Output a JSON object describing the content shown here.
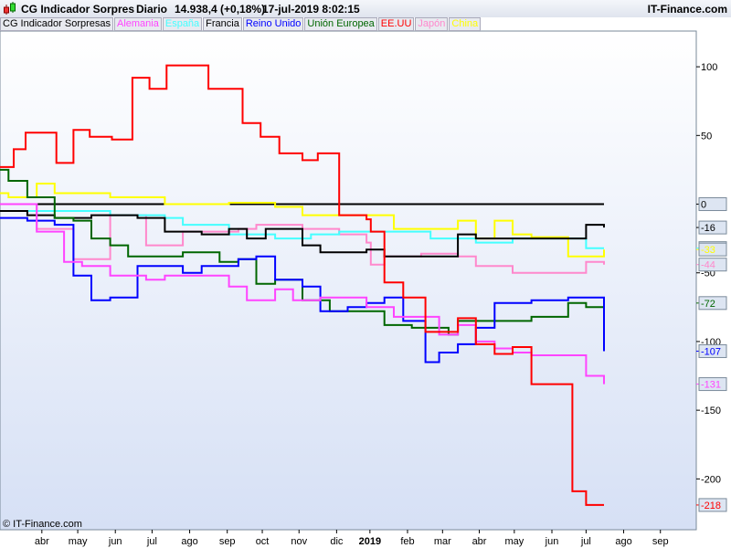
{
  "header": {
    "title": "CG Indicador Sorpres",
    "period": "Diario",
    "value": "14.938,4 (+0,18%)",
    "datetime": "17-jul-2019 8:02:15",
    "site": "IT-Finance.com"
  },
  "legend": [
    {
      "label": "CG Indicador Sorpresas",
      "color": "#000000"
    },
    {
      "label": "Alemania",
      "color": "#ff44ff"
    },
    {
      "label": "España",
      "color": "#44ffff"
    },
    {
      "label": "Francia",
      "color": "#000000"
    },
    {
      "label": "Reino Unido",
      "color": "#0000ff"
    },
    {
      "label": "Unión Europea",
      "color": "#006600"
    },
    {
      "label": "EE.UU",
      "color": "#ff0000"
    },
    {
      "label": "Japón",
      "color": "#ff88cc"
    },
    {
      "label": "China",
      "color": "#ffff00"
    }
  ],
  "copyright": "© IT-Finance.com",
  "chart_data": {
    "type": "line",
    "x_unit": "weeks since mid-March 2018",
    "xlim": [
      0,
      81.5
    ],
    "ylim": [
      -237,
      126
    ],
    "yticks": [
      100,
      50,
      0,
      -50,
      -100,
      -150,
      -200
    ],
    "xticks": [
      {
        "x": 4.9,
        "label": "abr"
      },
      {
        "x": 9.1,
        "label": "may"
      },
      {
        "x": 13.5,
        "label": "jun"
      },
      {
        "x": 17.8,
        "label": "jul"
      },
      {
        "x": 22.2,
        "label": "ago"
      },
      {
        "x": 26.6,
        "label": "sep"
      },
      {
        "x": 30.7,
        "label": "oct"
      },
      {
        "x": 35,
        "label": "nov"
      },
      {
        "x": 39.4,
        "label": "dic"
      },
      {
        "x": 43.3,
        "label": "2019",
        "bold": true
      },
      {
        "x": 47.7,
        "label": "feb"
      },
      {
        "x": 51.8,
        "label": "mar"
      },
      {
        "x": 56.1,
        "label": "abr"
      },
      {
        "x": 60.2,
        "label": "may"
      },
      {
        "x": 64.6,
        "label": "jun"
      },
      {
        "x": 68.6,
        "label": "jul"
      },
      {
        "x": 73,
        "label": "ago"
      },
      {
        "x": 77.3,
        "label": "sep"
      }
    ],
    "series": [
      {
        "name": "CG Indicador Sorpresas",
        "color": "#000000",
        "last": "0",
        "points": [
          [
            0,
            0
          ],
          [
            70.7,
            0
          ]
        ]
      },
      {
        "name": "Japón",
        "color": "#ff88cc",
        "last": "-44",
        "points": [
          [
            0,
            0
          ],
          [
            4.3,
            -18
          ],
          [
            8.6,
            -40
          ],
          [
            11.8,
            -40
          ],
          [
            12.9,
            -8
          ],
          [
            17.1,
            -30
          ],
          [
            21.4,
            -20
          ],
          [
            27.9,
            -18
          ],
          [
            30,
            -15
          ],
          [
            35.4,
            -18
          ],
          [
            39.7,
            -22
          ],
          [
            42.9,
            -28
          ],
          [
            43.4,
            -44
          ],
          [
            45,
            -38
          ],
          [
            49.3,
            -36
          ],
          [
            53.6,
            -38
          ],
          [
            55.7,
            -45
          ],
          [
            60,
            -50
          ],
          [
            66.5,
            -50
          ],
          [
            68.6,
            -42
          ],
          [
            70.7,
            -44
          ]
        ]
      },
      {
        "name": "España",
        "color": "#44ffff",
        "last": "-32",
        "points": [
          [
            0,
            -5
          ],
          [
            4.3,
            -5
          ],
          [
            8.6,
            -5
          ],
          [
            12.9,
            -8
          ],
          [
            19.3,
            -10
          ],
          [
            21.4,
            -15
          ],
          [
            26.8,
            -22
          ],
          [
            32.2,
            -25
          ],
          [
            36.4,
            -22
          ],
          [
            39.7,
            -20
          ],
          [
            45,
            -20
          ],
          [
            50.4,
            -25
          ],
          [
            55.7,
            -28
          ],
          [
            60,
            -25
          ],
          [
            66.5,
            -25
          ],
          [
            68.6,
            -32
          ],
          [
            70.7,
            -32
          ]
        ]
      },
      {
        "name": "China",
        "color": "#ffff00",
        "last": "-33",
        "points": [
          [
            0,
            8
          ],
          [
            1,
            5
          ],
          [
            4.3,
            15
          ],
          [
            6.4,
            8
          ],
          [
            12.9,
            5
          ],
          [
            19.3,
            0
          ],
          [
            26.8,
            1
          ],
          [
            32.2,
            -2
          ],
          [
            35.4,
            -8
          ],
          [
            39.7,
            -8
          ],
          [
            46.1,
            -18
          ],
          [
            53.6,
            -12
          ],
          [
            55.7,
            -25
          ],
          [
            57.9,
            -12
          ],
          [
            60,
            -22
          ],
          [
            62.2,
            -24
          ],
          [
            66.5,
            -38
          ],
          [
            70.7,
            -33
          ]
        ]
      },
      {
        "name": "Francia",
        "color": "#000000",
        "last": "-16",
        "points": [
          [
            0,
            -5
          ],
          [
            3.2,
            -8
          ],
          [
            6.4,
            -10
          ],
          [
            10.7,
            -8
          ],
          [
            16.1,
            -10
          ],
          [
            19.3,
            -20
          ],
          [
            23.6,
            -22
          ],
          [
            26.8,
            -18
          ],
          [
            28.9,
            -25
          ],
          [
            31.1,
            -18
          ],
          [
            35.4,
            -30
          ],
          [
            37.5,
            -35
          ],
          [
            42.9,
            -33
          ],
          [
            45,
            -38
          ],
          [
            51.4,
            -38
          ],
          [
            53.6,
            -22
          ],
          [
            55.7,
            -25
          ],
          [
            57.9,
            -25
          ],
          [
            66.5,
            -25
          ],
          [
            68.6,
            -15
          ],
          [
            70.7,
            -17
          ]
        ]
      },
      {
        "name": "Unión Europea",
        "color": "#006600",
        "last": "-72",
        "points": [
          [
            0,
            25
          ],
          [
            1,
            17
          ],
          [
            3.2,
            5
          ],
          [
            6.4,
            -10
          ],
          [
            8.6,
            -12
          ],
          [
            10.7,
            -25
          ],
          [
            12.9,
            -30
          ],
          [
            15,
            -38
          ],
          [
            19.3,
            -38
          ],
          [
            21.4,
            -35
          ],
          [
            25.7,
            -42
          ],
          [
            27.9,
            -40
          ],
          [
            30,
            -58
          ],
          [
            32.2,
            -55
          ],
          [
            35.4,
            -70
          ],
          [
            38.6,
            -78
          ],
          [
            42.9,
            -78
          ],
          [
            45,
            -88
          ],
          [
            48.2,
            -90
          ],
          [
            52.5,
            -95
          ],
          [
            53.6,
            -85
          ],
          [
            57.9,
            -85
          ],
          [
            62.2,
            -82
          ],
          [
            66.5,
            -72
          ],
          [
            68.6,
            -75
          ],
          [
            70.7,
            -72
          ]
        ]
      },
      {
        "name": "Reino Unido",
        "color": "#0000ff",
        "last": "-107",
        "points": [
          [
            0,
            -10
          ],
          [
            3.2,
            -12
          ],
          [
            6.4,
            -15
          ],
          [
            8.6,
            -52
          ],
          [
            10.7,
            -70
          ],
          [
            12.9,
            -68
          ],
          [
            16.1,
            -45
          ],
          [
            19.3,
            -45
          ],
          [
            21.4,
            -50
          ],
          [
            23.6,
            -45
          ],
          [
            27.9,
            -40
          ],
          [
            30,
            -38
          ],
          [
            32.2,
            -55
          ],
          [
            35.4,
            -60
          ],
          [
            37.5,
            -78
          ],
          [
            40.7,
            -75
          ],
          [
            42.9,
            -72
          ],
          [
            45,
            -68
          ],
          [
            47.2,
            -85
          ],
          [
            49.8,
            -115
          ],
          [
            51.4,
            -108
          ],
          [
            53.6,
            -102
          ],
          [
            55.7,
            -90
          ],
          [
            57.9,
            -72
          ],
          [
            62.2,
            -70
          ],
          [
            66.5,
            -68
          ],
          [
            68.6,
            -68
          ],
          [
            70.7,
            -107
          ]
        ]
      },
      {
        "name": "Alemania",
        "color": "#ff44ff",
        "last": "-131",
        "points": [
          [
            0,
            0
          ],
          [
            4.3,
            -20
          ],
          [
            7.5,
            -42
          ],
          [
            9.6,
            -45
          ],
          [
            12.9,
            -52
          ],
          [
            17.1,
            -55
          ],
          [
            19.3,
            -52
          ],
          [
            24.7,
            -52
          ],
          [
            26.8,
            -60
          ],
          [
            28.9,
            -70
          ],
          [
            32.2,
            -62
          ],
          [
            34.3,
            -70
          ],
          [
            37.5,
            -68
          ],
          [
            42.9,
            -75
          ],
          [
            46.1,
            -82
          ],
          [
            51.4,
            -95
          ],
          [
            53.6,
            -88
          ],
          [
            55.7,
            -100
          ],
          [
            57.9,
            -105
          ],
          [
            60,
            -108
          ],
          [
            62.2,
            -110
          ],
          [
            66.5,
            -110
          ],
          [
            68.6,
            -125
          ],
          [
            70.7,
            -131
          ]
        ]
      },
      {
        "name": "EE.UU",
        "color": "#ff0000",
        "last": "-218",
        "points": [
          [
            0,
            27
          ],
          [
            1.6,
            40
          ],
          [
            3,
            52
          ],
          [
            4.7,
            52
          ],
          [
            6.6,
            30
          ],
          [
            8.6,
            54
          ],
          [
            10.5,
            49
          ],
          [
            13.1,
            47
          ],
          [
            15.5,
            92
          ],
          [
            17.5,
            84
          ],
          [
            19.5,
            101
          ],
          [
            23.6,
            101
          ],
          [
            24.4,
            84
          ],
          [
            28.4,
            59
          ],
          [
            30.5,
            49
          ],
          [
            32.7,
            37
          ],
          [
            35.4,
            32
          ],
          [
            37.2,
            37
          ],
          [
            39.7,
            -8
          ],
          [
            42.9,
            -11
          ],
          [
            43.4,
            -20
          ],
          [
            45,
            -57
          ],
          [
            47.2,
            -68
          ],
          [
            49.8,
            -93
          ],
          [
            52,
            -93
          ],
          [
            53.6,
            -83
          ],
          [
            55.7,
            -102
          ],
          [
            57.9,
            -109
          ],
          [
            60,
            -104
          ],
          [
            62.2,
            -131
          ],
          [
            66.5,
            -131
          ],
          [
            67,
            -209
          ],
          [
            68.6,
            -219
          ],
          [
            70.7,
            -219
          ]
        ]
      }
    ]
  }
}
